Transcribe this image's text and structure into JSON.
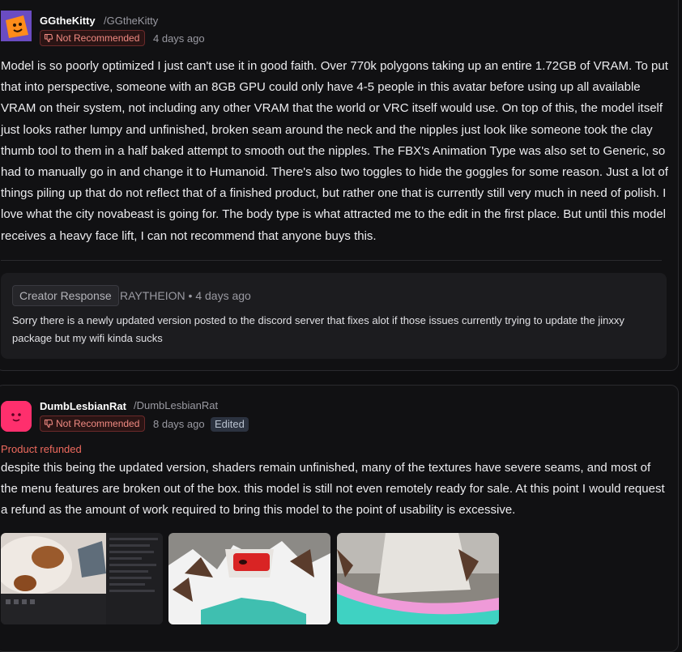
{
  "reviews": [
    {
      "username": "GGtheKitty",
      "handle": "/GGtheKitty",
      "verdict": "Not Recommended",
      "time_ago": "4 days ago",
      "body": "Model is so poorly optimized I just can't use it in good faith. Over 770k polygons taking up an entire 1.72GB of VRAM. To put that into perspective, someone with an 8GB GPU could only have 4-5 people in this avatar before using up all available VRAM on their system, not including any other VRAM that the world or VRC itself would use. On top of this, the model itself just looks rather lumpy and unfinished, broken seam around the neck and the nipples just look like someone took the clay thumb tool to them in a half baked attempt to smooth out the nipples. The FBX's Animation Type was also set to Generic, so had to manually go in and change it to Humanoid. There's also two toggles to hide the goggles for some reason. Just a lot of things piling up that do not reflect that of a finished product, but rather one that is currently still very much in need of polish. I love what the city novabeast is going for. The body type is what attracted me to the edit in the first place. But until this model receives a heavy face lift, I can not recommend that anyone buys this.",
      "avatar_color": "#6a4cc2",
      "creator_response": {
        "label": "Creator Response",
        "meta": "RAYTHEION • 4 days ago",
        "text": "Sorry there  is a newly updated version posted to the discord server that fixes alot if those issues currently trying to update the jinxxy package but my wifi kinda sucks"
      }
    },
    {
      "username": "DumbLesbianRat",
      "handle": "/DumbLesbianRat",
      "verdict": "Not Recommended",
      "time_ago": "8 days ago",
      "edited_label": "Edited",
      "refund_status": "Product refunded",
      "body": "despite this being the updated version, shaders remain unfinished, many of the textures have severe seams, and most of the menu features are broken out of the box. this model is still not even remotely ready for sale. At this point I would request a refund as the amount of work required to bring this model to the point of usability is excessive.",
      "avatar_color": "#ff2f6d",
      "attachments": [
        "screenshot-editor",
        "screenshot-avatar-face",
        "screenshot-avatar-neck"
      ]
    }
  ],
  "icons": {
    "thumbs_down": "thumbs-down-icon"
  },
  "colors": {
    "not_recommended": "#f08a82",
    "refunded": "#ef6a5e",
    "background": "#0e0e10"
  }
}
